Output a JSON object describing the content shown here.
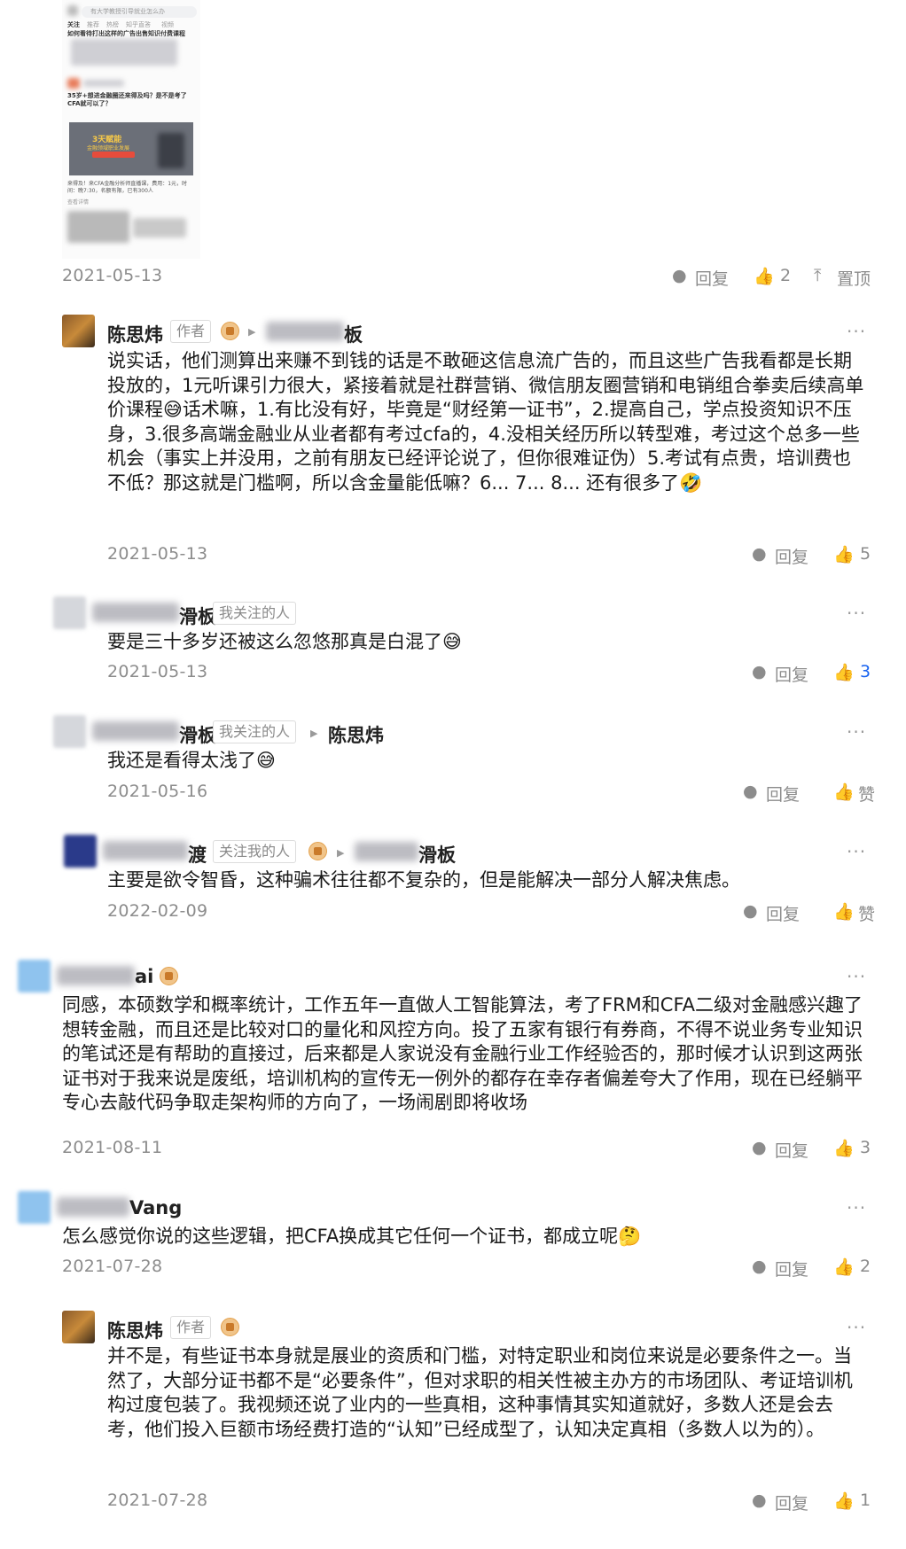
{
  "embedded_screenshot": {
    "tabs": [
      "关注",
      "推荐",
      "热榜",
      "知乎直答",
      "视频"
    ],
    "search_placeholder": "有大学教授引导就业怎么办",
    "headline": "如何看待打出这样的广告出售知识付费课程",
    "post_line": "35岁+想进金融圈还来得及吗？是不是考了CFA就可以了？",
    "ad_title": "3天赋能",
    "ad_subtitle": "金融领域职业发展",
    "ad_caption": "来得及！来CFA金融分析师直播课，费用：1元，时间：晚7:30，名额有限，已有300人",
    "ad_link": "查看详情"
  },
  "top_item": {
    "date": "2021-05-13",
    "reply_label": "回复",
    "like_count": "2",
    "pin_label": "置顶"
  },
  "comments": [
    {
      "author": "陈思炜",
      "author_tag": "作者",
      "reply_to_suffix": "板",
      "text": "说实话，他们测算出来赚不到钱的话是不敢砸这信息流广告的，而且这些广告我看都是长期投放的，1元听课引力很大，紧接着就是社群营销、微信朋友圈营销和电销组合拳卖后续高单价课程😅话术嘛，1.有比没有好，毕竟是“财经第一证书”，2.提高自己，学点投资知识不压身，3.很多高端金融业从业者都有考过cfa的，4.没相关经历所以转型难，考过这个总多一些机会（事实上并没用，之前有朋友已经评论说了，但你很难证伪）5.考试有点贵，培训费也不低？那这就是门槛啊，所以含金量能低嘛？6... 7... 8... 还有很多了🤣",
      "date": "2021-05-13",
      "reply_label": "回复",
      "like": "5"
    },
    {
      "author_suffix": "滑板",
      "author_tag": "我关注的人",
      "text": "要是三十多岁还被这么忽悠那真是白混了😅",
      "date": "2021-05-13",
      "reply_label": "回复",
      "like": "3"
    },
    {
      "author_suffix": "滑板",
      "author_tag": "我关注的人",
      "reply_to": "陈思炜",
      "text": "我还是看得太浅了😅",
      "date": "2021-05-16",
      "reply_label": "回复",
      "like": "赞"
    },
    {
      "author_suffix": "渡",
      "author_tag": "关注我的人",
      "reply_to_suffix": "滑板",
      "text": "主要是欲令智昏，这种骗术往往都不复杂的，但是能解决一部分人解决焦虑。",
      "date": "2022-02-09",
      "reply_label": "回复",
      "like": "赞"
    },
    {
      "author_suffix": "ai",
      "text": "同感，本硕数学和概率统计，工作五年一直做人工智能算法，考了FRM和CFA二级对金融感兴趣了想转金融，而且还是比较对口的量化和风控方向。投了五家有银行有券商，不得不说业务专业知识的笔试还是有帮助的直接过，后来都是人家说没有金融行业工作经验否的，那时候才认识到这两张证书对于我来说是废纸，培训机构的宣传无一例外的都存在幸存者偏差夸大了作用，现在已经躺平专心去敲代码争取走架构师的方向了，一场闹剧即将收场",
      "date": "2021-08-11",
      "reply_label": "回复",
      "like": "3"
    },
    {
      "author_suffix": "Vang",
      "text": "怎么感觉你说的这些逻辑，把CFA换成其它任何一个证书，都成立呢🤔",
      "date": "2021-07-28",
      "reply_label": "回复",
      "like": "2"
    },
    {
      "author": "陈思炜",
      "author_tag": "作者",
      "text": "并不是，有些证书本身就是展业的资质和门槛，对特定职业和岗位来说是必要条件之一。当然了，大部分证书都不是“必要条件”，但对求职的相关性被主办方的市场团队、考证培训机构过度包装了。我视频还说了业内的一些真相，这种事情其实知道就好，多数人还是会去考，他们投入巨额市场经费打造的“认知”已经成型了，认知决定真相（多数人以为的）。",
      "date": "2021-07-28",
      "reply_label": "回复",
      "like": "1"
    }
  ],
  "colors": {
    "accent": "#1a64f0",
    "muted": "#8c8c8c",
    "text": "#1a1a1a"
  },
  "icons": [
    "comment-icon",
    "thumb-up-icon",
    "pin-icon",
    "more-icon",
    "verified-badge-icon",
    "triangle-arrow-icon"
  ]
}
